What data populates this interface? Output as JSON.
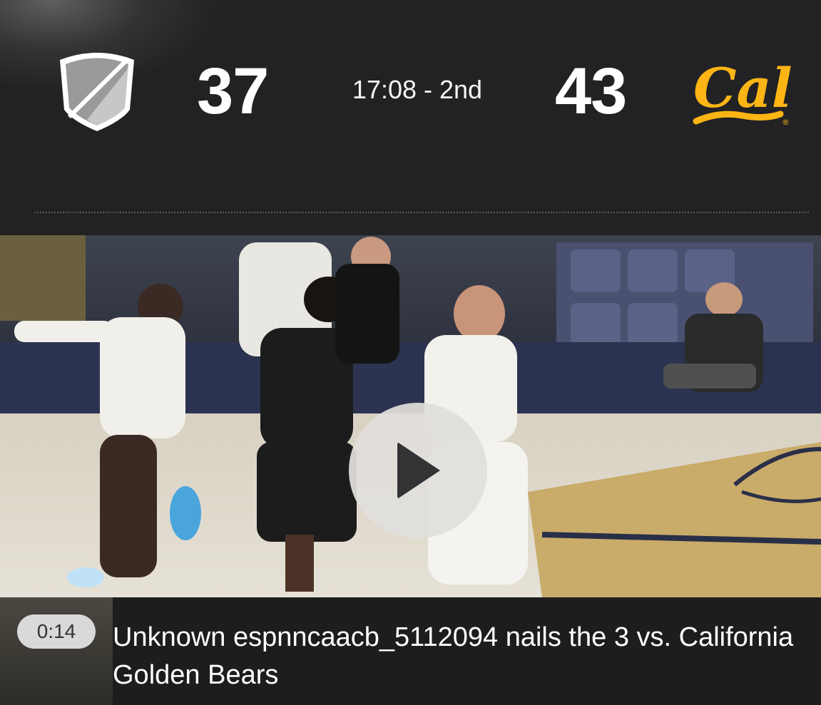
{
  "scoreboard": {
    "away": {
      "logo_icon": "shield-placeholder-icon",
      "score": "37"
    },
    "clock": "17:08 - 2nd",
    "home": {
      "logo_text": "Cal",
      "registered_mark": "®",
      "score": "43",
      "color": "#FDB515"
    }
  },
  "video": {
    "play_icon": "play-icon",
    "duration": "0:14",
    "caption": "Unknown espnncaacb_5112094 nails the 3 vs. California Golden Bears"
  }
}
